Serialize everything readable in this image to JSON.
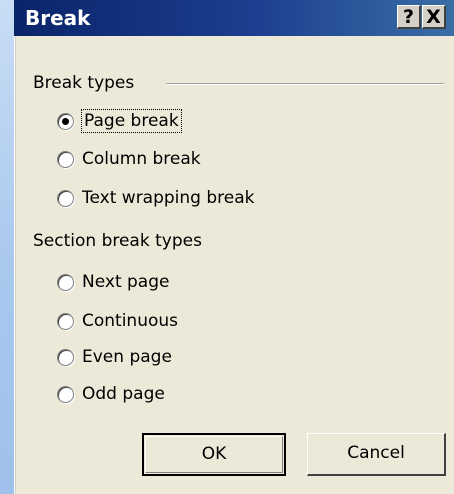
{
  "window": {
    "title": "Break",
    "help_icon": "?",
    "close_icon": "X"
  },
  "break_types": {
    "label": "Break types",
    "options": [
      {
        "label": "Page break",
        "selected": true
      },
      {
        "label": "Column break",
        "selected": false
      },
      {
        "label": "Text wrapping break",
        "selected": false
      }
    ]
  },
  "section_break_types": {
    "label": "Section break types",
    "options": [
      {
        "label": "Next page",
        "selected": false
      },
      {
        "label": "Continuous",
        "selected": false
      },
      {
        "label": "Even page",
        "selected": false
      },
      {
        "label": "Odd page",
        "selected": false
      }
    ]
  },
  "buttons": {
    "ok": "OK",
    "cancel": "Cancel"
  },
  "colors": {
    "titlebar": "#0a246a",
    "dialog_bg": "#ece9d8",
    "desktop": "#a9c8ee"
  }
}
